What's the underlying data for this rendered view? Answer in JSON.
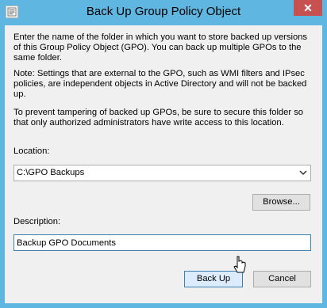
{
  "window": {
    "title": "Back Up Group Policy Object",
    "close_label": "✕",
    "icon": "gpo-app-icon"
  },
  "content": {
    "intro": "Enter the name of the folder in which you want to store backed up versions of this Group Policy Object (GPO). You can back up multiple GPOs to the same folder.",
    "note": "Note: Settings that are external to the GPO, such as WMI filters and IPsec policies, are independent objects in Active Directory and will not be backed up.",
    "security": "To prevent tampering of backed up GPOs, be sure to secure this folder so that only authorized administrators have write access to this location."
  },
  "location": {
    "label": "Location:",
    "value": "C:\\GPO Backups",
    "browse_label": "Browse..."
  },
  "description": {
    "label": "Description:",
    "value": "Backup GPO Documents"
  },
  "buttons": {
    "backup_label": "Back Up",
    "cancel_label": "Cancel"
  },
  "colors": {
    "titlebar": "#5fb6e0",
    "close": "#c75050",
    "focus_border": "#3c7fb1"
  }
}
